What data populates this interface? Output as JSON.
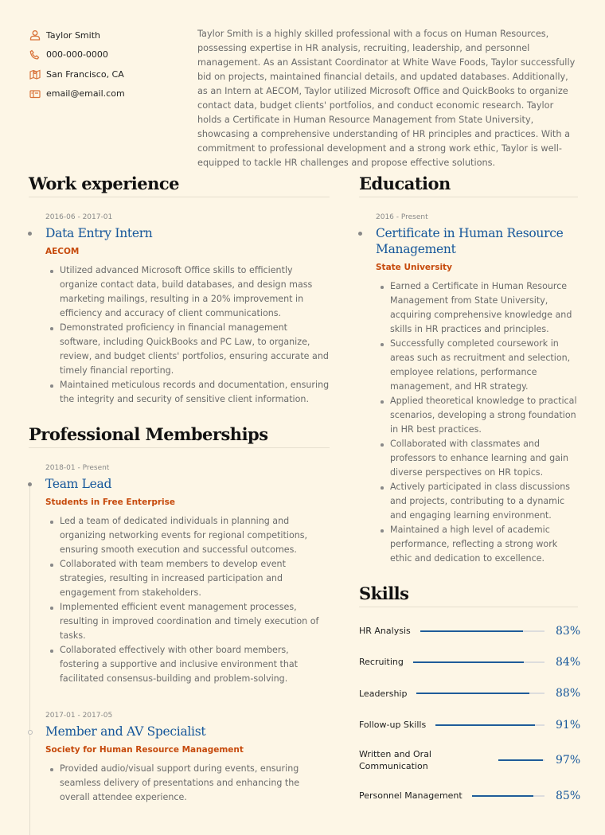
{
  "contact": {
    "name": "Taylor Smith",
    "phone": "000-000-0000",
    "location": "San Francisco, CA",
    "email": "email@email.com"
  },
  "summary": "Taylor Smith is a highly skilled professional with a focus on Human Resources, possessing expertise in HR analysis, recruiting, leadership, and personnel management. As an Assistant Coordinator at White Wave Foods, Taylor successfully bid on projects, maintained financial details, and updated databases. Additionally, as an Intern at AECOM, Taylor utilized Microsoft Office and QuickBooks to organize contact data, budget clients' portfolios, and conduct economic research. Taylor holds a Certificate in Human Resource Management from State University, showcasing a comprehensive understanding of HR principles and practices. With a commitment to professional development and a strong work ethic, Taylor is well-equipped to tackle HR challenges and propose effective solutions.",
  "colors": {
    "accent_blue": "#15569a",
    "accent_orange": "#c64a0c",
    "icon_orange": "#d9733a",
    "background": "#fdf6e6"
  },
  "work": {
    "title": "Work experience",
    "entries": [
      {
        "date": "2016-06 - 2017-01",
        "title": "Data Entry Intern",
        "org": "AECOM",
        "bullets": [
          "Utilized advanced Microsoft Office skills to efficiently organize contact data, build databases, and design mass marketing mailings, resulting in a 20% improvement in efficiency and accuracy of client communications.",
          "Demonstrated proficiency in financial management software, including QuickBooks and PC Law, to organize, review, and budget clients' portfolios, ensuring accurate and timely financial reporting.",
          "Maintained meticulous records and documentation, ensuring the integrity and security of sensitive client information."
        ]
      }
    ]
  },
  "memberships": {
    "title": "Professional Memberships",
    "entries": [
      {
        "date": "2018-01 - Present",
        "title": "Team Lead",
        "org": "Students in Free Enterprise",
        "bullets": [
          "Led a team of dedicated individuals in planning and organizing networking events for regional competitions, ensuring smooth execution and successful outcomes.",
          "Collaborated with team members to develop event strategies, resulting in increased participation and engagement from stakeholders.",
          "Implemented efficient event management processes, resulting in improved coordination and timely execution of tasks.",
          "Collaborated effectively with other board members, fostering a supportive and inclusive environment that facilitated consensus-building and problem-solving."
        ]
      },
      {
        "date": "2017-01 - 2017-05",
        "title": "Member and AV Specialist",
        "org": "Society for Human Resource Management",
        "bullets": [
          "Provided audio/visual support during events, ensuring seamless delivery of presentations and enhancing the overall attendee experience."
        ]
      }
    ]
  },
  "education": {
    "title": "Education",
    "entries": [
      {
        "date": "2016 - Present",
        "title": "Certificate in Human Resource Management",
        "org": "State University",
        "bullets": [
          "Earned a Certificate in Human Resource Management from State University, acquiring comprehensive knowledge and skills in HR practices and principles.",
          "Successfully completed coursework in areas such as recruitment and selection, employee relations, performance management, and HR strategy.",
          "Applied theoretical knowledge to practical scenarios, developing a strong foundation in HR best practices.",
          "Collaborated with classmates and professors to enhance learning and gain diverse perspectives on HR topics.",
          "Actively participated in class discussions and projects, contributing to a dynamic and engaging learning environment.",
          "Maintained a high level of academic performance, reflecting a strong work ethic and dedication to excellence."
        ]
      }
    ]
  },
  "skills": {
    "title": "Skills",
    "items": [
      {
        "label": "HR Analysis",
        "pct_text": "83%",
        "value": 0.83
      },
      {
        "label": "Recruiting",
        "pct_text": "84%",
        "value": 0.84
      },
      {
        "label": "Leadership",
        "pct_text": "88%",
        "value": 0.88
      },
      {
        "label": "Follow-up Skills",
        "pct_text": "91%",
        "value": 0.91
      },
      {
        "label": "Written and Oral Communication",
        "pct_text": "97%",
        "value": 0.97
      },
      {
        "label": "Personnel Management",
        "pct_text": "85%",
        "value": 0.85
      }
    ]
  }
}
